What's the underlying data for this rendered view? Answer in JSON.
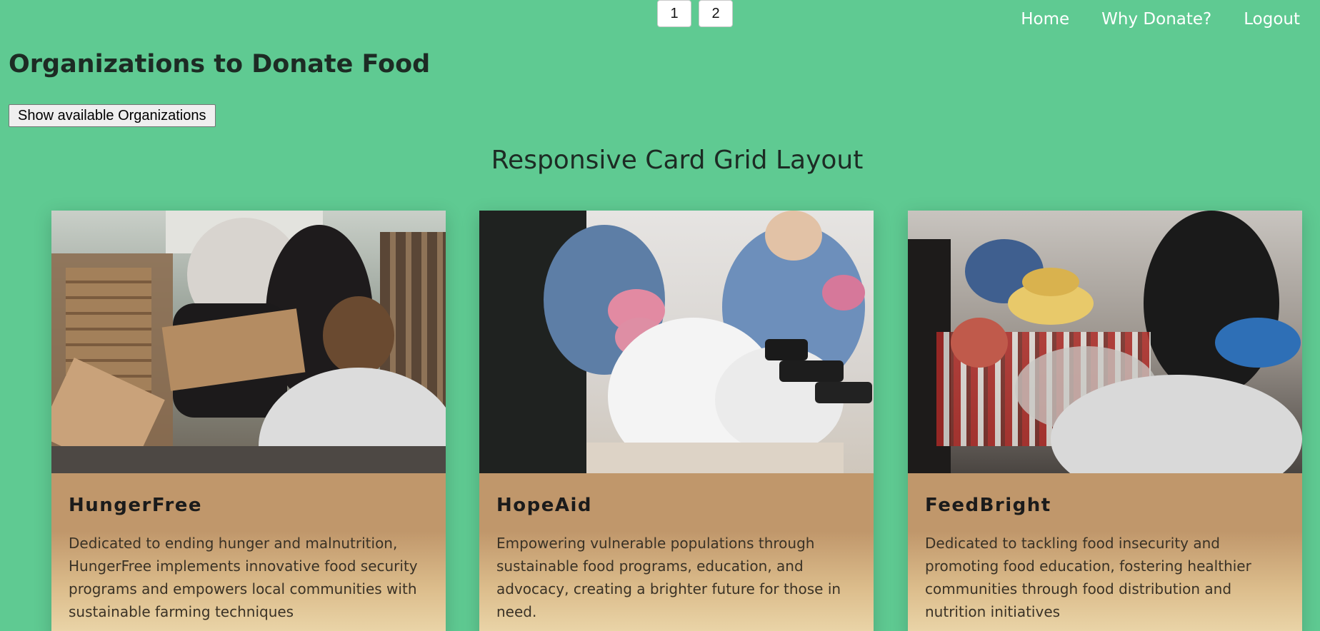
{
  "pagination": {
    "pages": [
      "1",
      "2"
    ]
  },
  "nav": {
    "home": "Home",
    "why": "Why Donate?",
    "logout": "Logout"
  },
  "header": {
    "title": "Organizations to Donate Food",
    "show_button": "Show available Organizations"
  },
  "section": {
    "title": "Responsive Card Grid Layout"
  },
  "cards": [
    {
      "title": "HungerFree",
      "text": "Dedicated to ending hunger and malnutrition, HungerFree implements innovative food security programs and empowers local communities with sustainable farming techniques"
    },
    {
      "title": "HopeAid",
      "text": "Empowering vulnerable populations through sustainable food programs, education, and advocacy, creating a brighter future for those in need."
    },
    {
      "title": "FeedBright",
      "text": "Dedicated to tackling food insecurity and promoting food education, fostering healthier communities through food distribution and nutrition initiatives"
    }
  ],
  "colors": {
    "background": "#5fca92",
    "card_body_top": "#c0976b",
    "card_body_bottom": "#ecd8ac"
  }
}
